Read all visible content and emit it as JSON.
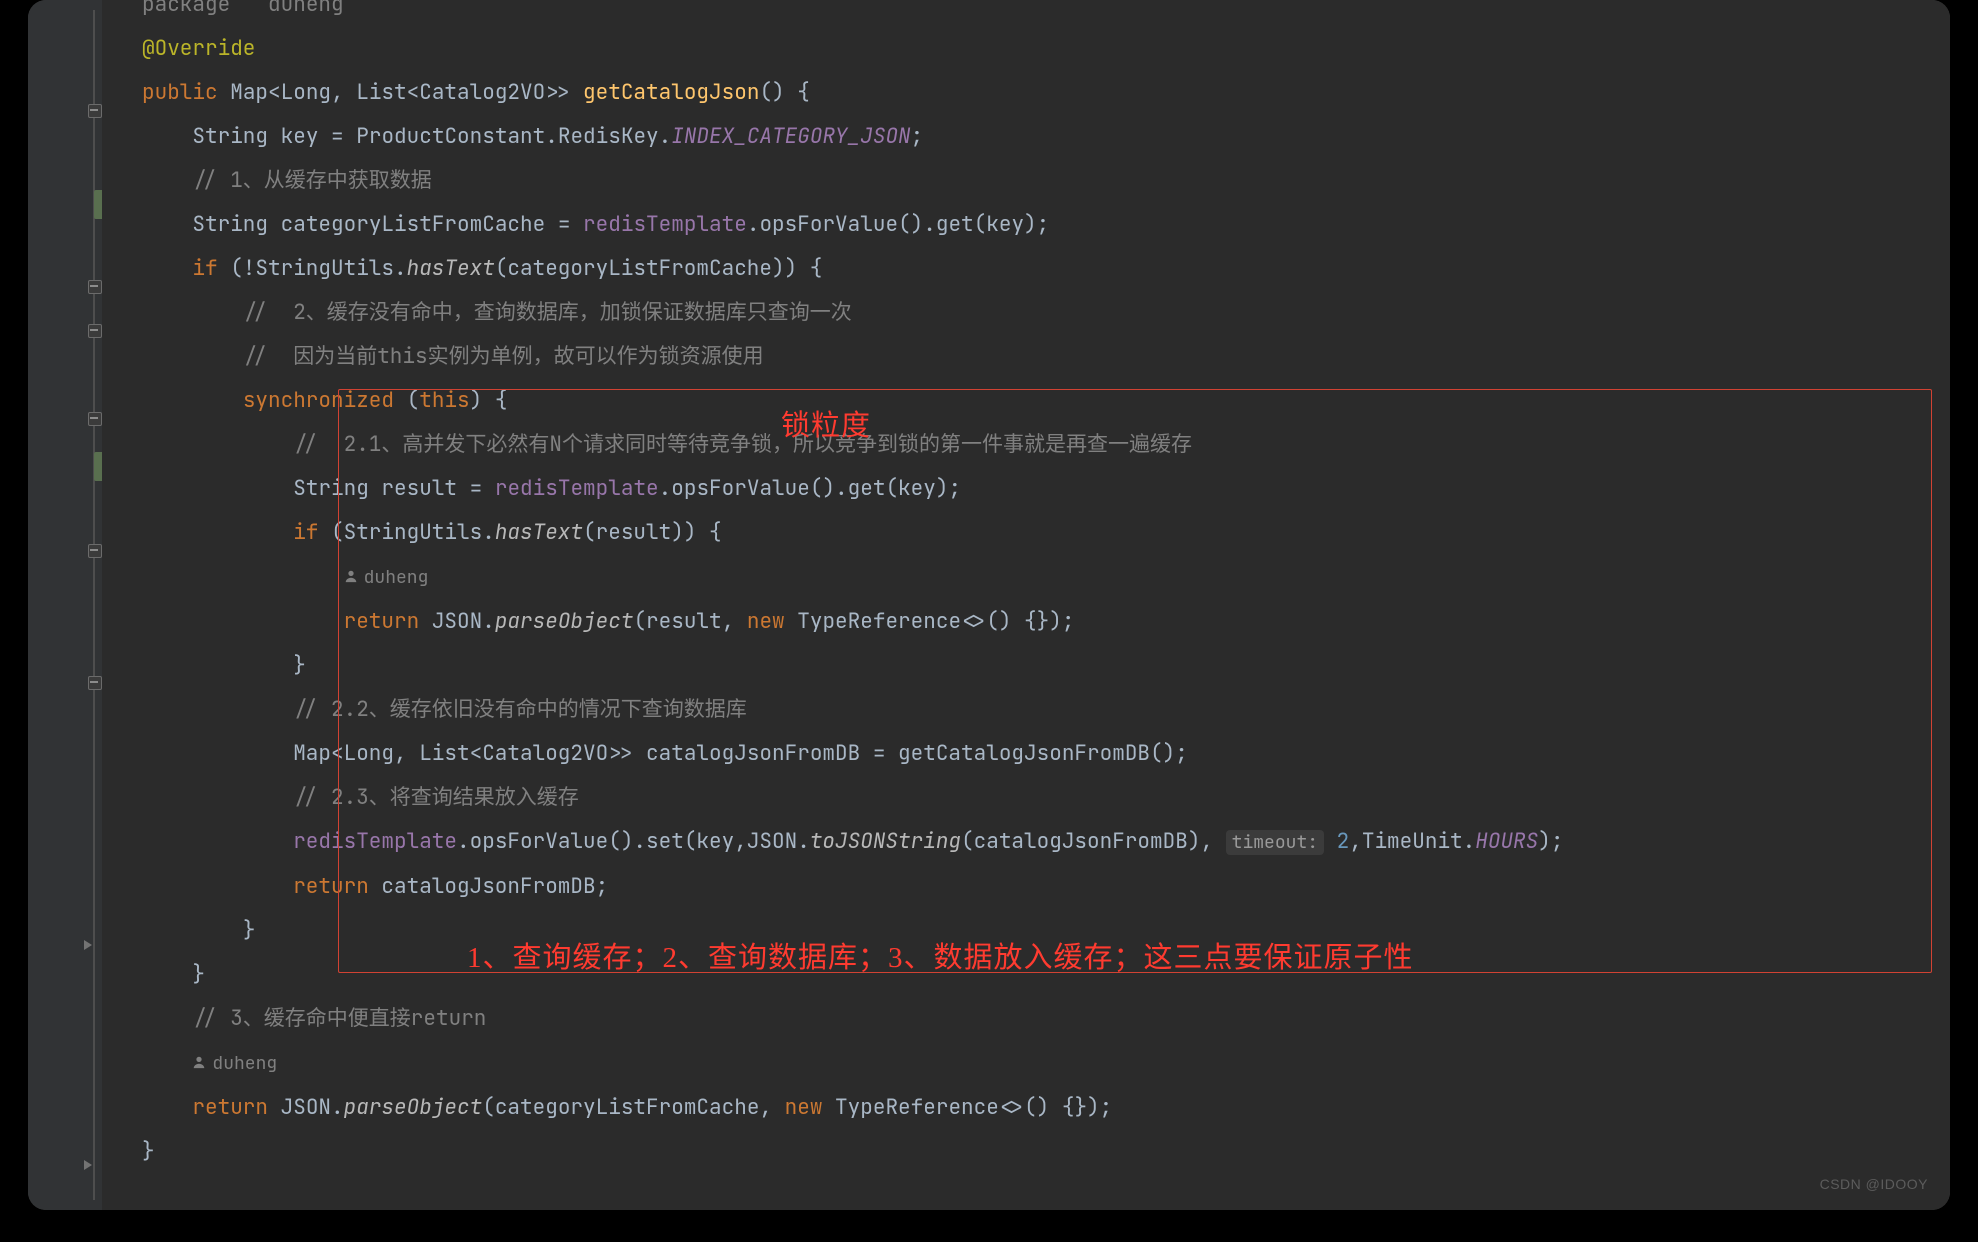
{
  "watermark": "CSDN @IDOOY",
  "annotations": {
    "box_label_1": "锁粒度",
    "box_label_2": "1、查询缓存；2、查询数据库；3、数据放入缓存；这三点要保证原子性"
  },
  "inlay": {
    "timeout_label": "timeout:"
  },
  "author": {
    "name1": "duheng",
    "name2": "duheng"
  },
  "code": {
    "l0": {
      "pkg": "package",
      "sp": "   ",
      "id": "duheng"
    },
    "l1": {
      "ann": "@Override"
    },
    "l2": {
      "kw_public": "public",
      "type": "Map<Long, List<Catalog2VO>>",
      "method": "getCatalogJson",
      "tail": "() {"
    },
    "l3": {
      "type": "String",
      "var": "key",
      "eq": " = ",
      "cls": "ProductConstant.RedisKey.",
      "field": "INDEX_CATEGORY_JSON",
      "semi": ";"
    },
    "l4": {
      "comment": "// 1、从缓存中获取数据"
    },
    "l5": {
      "type": "String",
      "var": "categoryListFromCache",
      "eq": " = ",
      "obj": "redisTemplate",
      "call": ".opsForValue().get(key);"
    },
    "l6": {
      "kw": "if",
      "open": " (!StringUtils.",
      "m": "hasText",
      "tail": "(categoryListFromCache)) {"
    },
    "l7": {
      "comment": "//  2、缓存没有命中，查询数据库，加锁保证数据库只查询一次"
    },
    "l8": {
      "comment": "//  因为当前this实例为单例，故可以作为锁资源使用"
    },
    "l9": {
      "kw": "synchronized",
      "open": " (",
      "this": "this",
      "tail": ") {"
    },
    "l10": {
      "comment": "//  2.1、高并发下必然有N个请求同时等待竞争锁，所以竞争到锁的第一件事就是再查一遍缓存"
    },
    "l11": {
      "type": "String",
      "var": "result",
      "eq": " = ",
      "obj": "redisTemplate",
      "call": ".opsForValue().get(key);"
    },
    "l12": {
      "kw": "if",
      "open": " (StringUtils.",
      "m": "hasText",
      "tail": "(result)) {"
    },
    "l13_author": true,
    "l14": {
      "kw": "return",
      "cls": " JSON.",
      "m": "parseObject",
      "args": "(result, ",
      "new": "new",
      "t": " TypeReference<>() {});"
    },
    "l15": {
      "brace": "}"
    },
    "l16": {
      "comment": "// 2.2、缓存依旧没有命中的情况下查询数据库"
    },
    "l17": {
      "type": "Map<Long, List<Catalog2VO>>",
      "var": "catalogJsonFromDB",
      "eq": " = getCatalogJsonFromDB();"
    },
    "l18": {
      "comment": "// 2.3、将查询结果放入缓存"
    },
    "l19": {
      "obj": "redisTemplate",
      "p1": ".opsForValue().set(key,JSON.",
      "m": "toJSONString",
      "p2": "(catalogJsonFromDB),",
      "hint": true,
      "num": " 2",
      "tail2": ",TimeUnit.",
      "field": "HOURS",
      "end": ");"
    },
    "l20": {
      "kw": "return",
      "tail": " catalogJsonFromDB;"
    },
    "l21": {
      "brace": "}"
    },
    "l22": {
      "brace": "}"
    },
    "l23": {
      "comment": "// 3、缓存命中便直接return"
    },
    "l24_author": true,
    "l25": {
      "kw": "return",
      "cls": " JSON.",
      "m": "parseObject",
      "args": "(categoryListFromCache, ",
      "new": "new",
      "t": " TypeReference<>() {});"
    },
    "l26": {
      "brace": "}"
    }
  }
}
